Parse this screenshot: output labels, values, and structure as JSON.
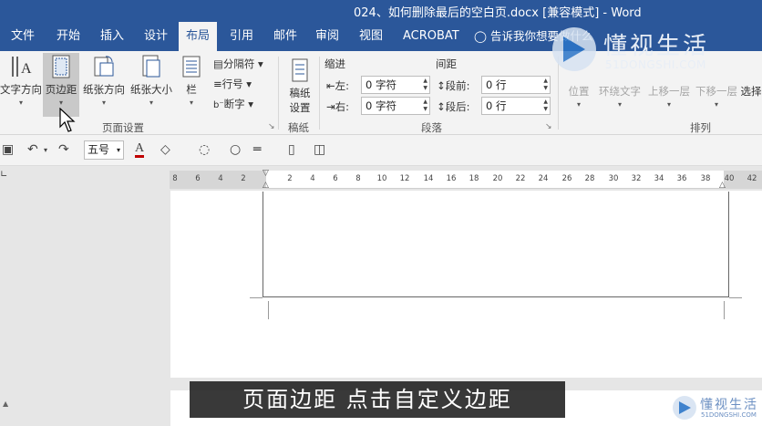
{
  "window": {
    "title": "024、如何删除最后的空白页.docx [兼容模式] - Word"
  },
  "tabs": [
    {
      "label": "文件",
      "active": false
    },
    {
      "label": "开始",
      "active": false
    },
    {
      "label": "插入",
      "active": false
    },
    {
      "label": "设计",
      "active": false
    },
    {
      "label": "布局",
      "active": true
    },
    {
      "label": "引用",
      "active": false
    },
    {
      "label": "邮件",
      "active": false
    },
    {
      "label": "审阅",
      "active": false
    },
    {
      "label": "视图",
      "active": false
    },
    {
      "label": "ACROBAT",
      "active": false
    }
  ],
  "tell_me": "告诉我你想要做什么",
  "ribbon": {
    "page_setup": {
      "text_direction": "文字方向",
      "margins": "页边距",
      "orientation": "纸张方向",
      "size": "纸张大小",
      "columns": "栏",
      "breaks": "分隔符",
      "line_numbers": "行号",
      "hyphenation": "断字",
      "group_label": "页面设置"
    },
    "manuscript": {
      "settings_line1": "稿纸",
      "settings_line2": "设置",
      "group_label": "稿纸"
    },
    "paragraph": {
      "indent_title": "缩进",
      "spacing_title": "间距",
      "left_label": "左:",
      "left_value": "0 字符",
      "right_label": "右:",
      "right_value": "0 字符",
      "before_label": "段前:",
      "before_value": "0 行",
      "after_label": "段后:",
      "after_value": "0 行",
      "group_label": "段落"
    },
    "arrange": {
      "position": "位置",
      "wrap_text": "环绕文字",
      "bring_forward": "上移一层",
      "send_backward": "下移一层",
      "select": "选择",
      "group_label": "排列"
    }
  },
  "qat": {
    "font_size": "五号"
  },
  "ruler": {
    "ticks": [
      "8",
      "6",
      "4",
      "2",
      "2",
      "4",
      "6",
      "8",
      "10",
      "12",
      "14",
      "16",
      "18",
      "20",
      "22",
      "24",
      "26",
      "28",
      "30",
      "32",
      "34",
      "36",
      "38",
      "40",
      "42"
    ]
  },
  "subtitle": "页面边距 点击自定义边距",
  "watermark": {
    "name": "懂视生活",
    "url": "51DONGSHI.COM",
    "small_name": "懂视生活",
    "small_url": "51DONGSHI.COM"
  },
  "colors": {
    "word_blue": "#2b579a",
    "ribbon_bg": "#f3f3f3",
    "font_color_red": "#c00000"
  }
}
